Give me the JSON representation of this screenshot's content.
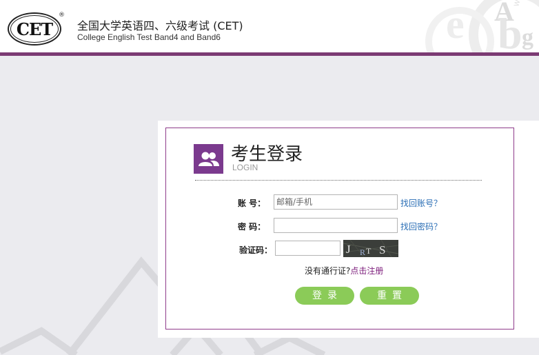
{
  "header": {
    "logo_text": "CET",
    "logo_reg": "®",
    "title_cn": "全国大学英语四、六级考试 (CET)",
    "title_en": "College English Test Band4 and Band6",
    "deco_letters": [
      "A",
      "b",
      "g"
    ]
  },
  "login": {
    "icon": "users-icon",
    "title": "考生登录",
    "subtitle": "LOGIN",
    "account_label": "账  号：",
    "account_placeholder": "邮箱/手机",
    "account_value": "",
    "find_account_link": "找回账号？",
    "password_label": "密  码：",
    "password_value": "",
    "find_password_link": "找回密码？",
    "captcha_label": "验证码：",
    "captcha_value": "",
    "captcha_text": [
      "J",
      "R",
      "T",
      "S"
    ],
    "register_prompt": "没有通行证?",
    "register_link": "点击注册",
    "login_button": "登录",
    "reset_button": "重置"
  },
  "colors": {
    "accent": "#7b3a73",
    "card_border": "#8e3a8a",
    "link": "#2a6eb5",
    "button": "#8bcb58",
    "background": "#ebebef"
  }
}
